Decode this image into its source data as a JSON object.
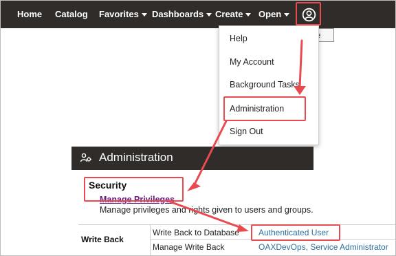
{
  "nav": {
    "home": "Home",
    "catalog": "Catalog",
    "favorites": "Favorites",
    "dashboards": "Dashboards",
    "create": "Create",
    "open": "Open"
  },
  "tooltip": "My Profile",
  "profile_menu": [
    "Help",
    "My Account",
    "Background Tasks",
    "Administration",
    "Sign Out"
  ],
  "admin": {
    "title": "Administration",
    "security_heading": "Security",
    "manage_privileges": "Manage Privileges",
    "manage_description": "Manage privileges and rights given to users and groups."
  },
  "write_back": {
    "label": "Write Back",
    "rows": [
      {
        "name": "Write Back to Database",
        "value": "Authenticated User"
      },
      {
        "name": "Manage Write Back",
        "value": "OAXDevOps, Service Administrator"
      }
    ]
  },
  "colors": {
    "nav_bg": "#2f2c29",
    "highlight": "#e84a4f",
    "link": "#2d6e9b",
    "visited_link": "#6a1b7c"
  }
}
